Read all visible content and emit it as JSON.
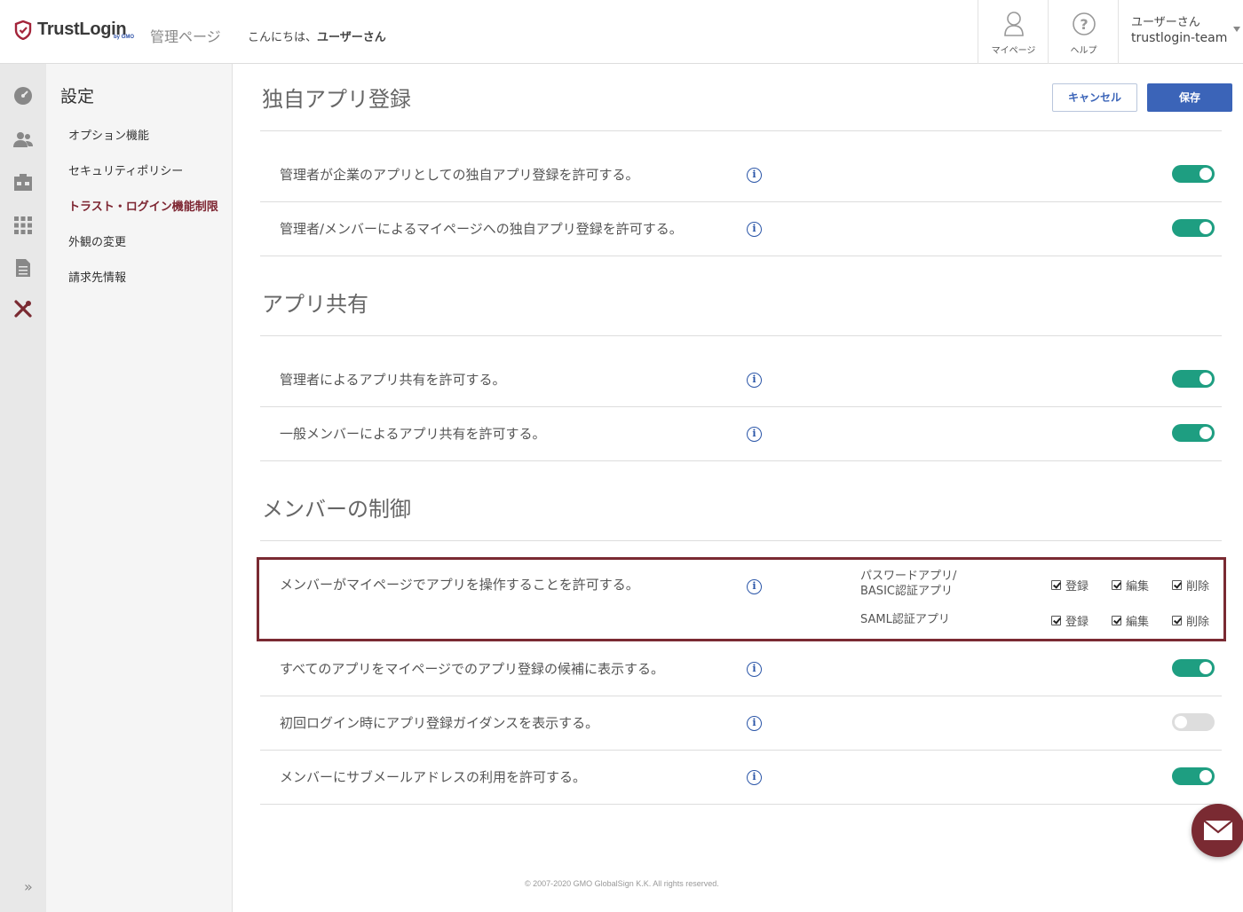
{
  "header": {
    "logo_text": "TrustLogin",
    "logo_sub": "by GMO",
    "admin_label": "管理ページ",
    "greeting_prefix": "こんにちは、",
    "greeting_user": "ユーザーさん",
    "mypage_label": "マイページ",
    "help_label": "ヘルプ",
    "user_name": "ユーザーさん",
    "team_name": "trustlogin-team"
  },
  "sidebar": {
    "title": "設定",
    "items": [
      {
        "label": "オプション機能"
      },
      {
        "label": "セキュリティポリシー"
      },
      {
        "label": "トラスト・ログイン機能制限"
      },
      {
        "label": "外観の変更"
      },
      {
        "label": "請求先情報"
      }
    ],
    "active_index": 2
  },
  "actions": {
    "cancel": "キャンセル",
    "save": "保存"
  },
  "sections": {
    "s1": {
      "title": "独自アプリ登録",
      "rows": [
        {
          "text": "管理者が企業のアプリとしての独自アプリ登録を許可する。",
          "on": true
        },
        {
          "text": "管理者/メンバーによるマイページへの独自アプリ登録を許可する。",
          "on": true
        }
      ]
    },
    "s2": {
      "title": "アプリ共有",
      "rows": [
        {
          "text": "管理者によるアプリ共有を許可する。",
          "on": true
        },
        {
          "text": "一般メンバーによるアプリ共有を許可する。",
          "on": true
        }
      ]
    },
    "s3": {
      "title": "メンバーの制御",
      "perm_row": {
        "text": "メンバーがマイページでアプリを操作することを許可する。",
        "groups": [
          {
            "label_line1": "パスワードアプリ/",
            "label_line2": "BASIC認証アプリ",
            "register": "登録",
            "edit": "編集",
            "delete": "削除",
            "checked": [
              true,
              true,
              true
            ]
          },
          {
            "label_line1": "SAML認証アプリ",
            "label_line2": "",
            "register": "登録",
            "edit": "編集",
            "delete": "削除",
            "checked": [
              true,
              true,
              true
            ]
          }
        ]
      },
      "rows": [
        {
          "text": "すべてのアプリをマイページでのアプリ登録の候補に表示する。",
          "on": true
        },
        {
          "text": "初回ログイン時にアプリ登録ガイダンスを表示する。",
          "on": false
        },
        {
          "text": "メンバーにサブメールアドレスの利用を許可する。",
          "on": true
        }
      ]
    }
  },
  "info_glyph": "i",
  "footer": "© 2007-2020 GMO GlobalSign K.K. All rights reserved.",
  "colors": {
    "brand": "#7a2a32",
    "accent": "#3b64b8",
    "toggle_on": "#1e9e81",
    "toggle_off": "#dddddd"
  }
}
